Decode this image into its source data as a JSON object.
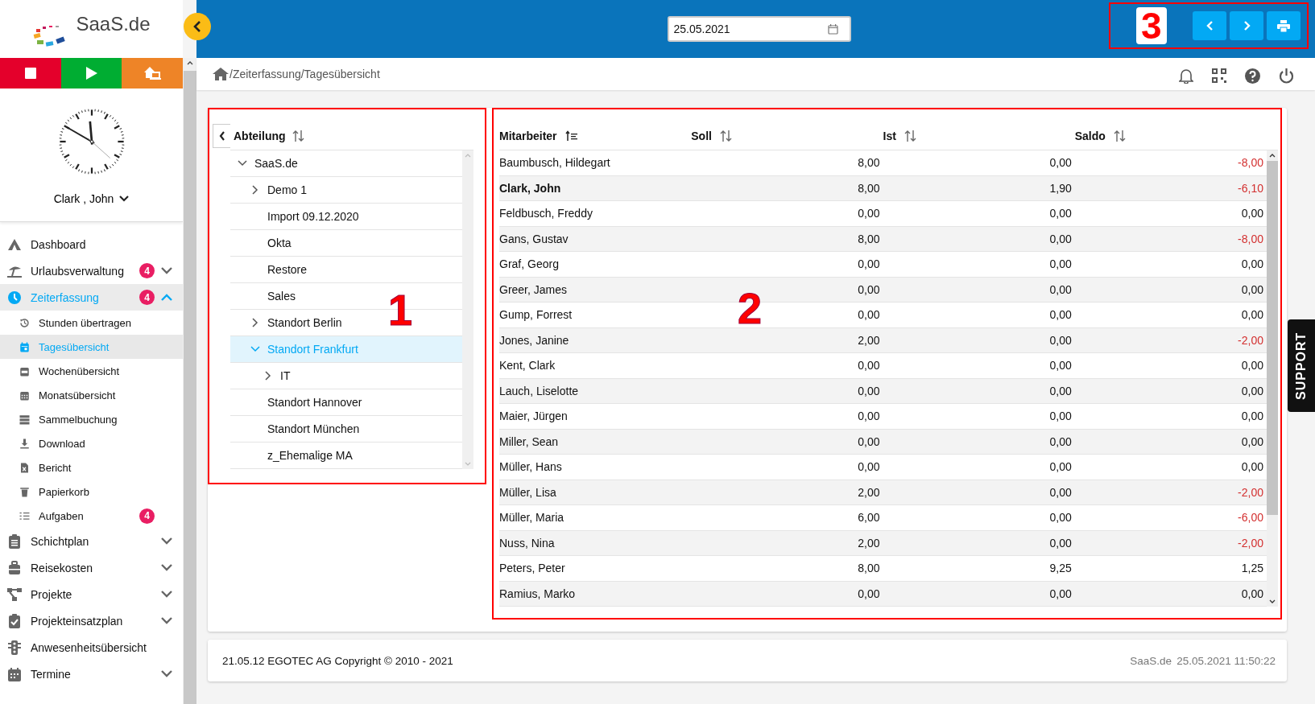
{
  "header": {
    "date": "25.05.2021"
  },
  "sidebar": {
    "logo": "SaaS.de",
    "user": "Clark , John",
    "nav": [
      {
        "label": "Dashboard",
        "kind": "main",
        "selected": false
      },
      {
        "label": "Urlaubsverwaltung",
        "kind": "main",
        "selected": false,
        "badge": "4",
        "expanded": false
      },
      {
        "label": "Zeiterfassung",
        "kind": "main",
        "selected": true,
        "badge": "4",
        "expanded": true
      },
      {
        "label": "Stunden übertragen",
        "kind": "sub",
        "selected": false
      },
      {
        "label": "Tagesübersicht",
        "kind": "sub",
        "selected": true
      },
      {
        "label": "Wochenübersicht",
        "kind": "sub",
        "selected": false
      },
      {
        "label": "Monatsübersicht",
        "kind": "sub",
        "selected": false
      },
      {
        "label": "Sammelbuchung",
        "kind": "sub",
        "selected": false
      },
      {
        "label": "Download",
        "kind": "sub",
        "selected": false
      },
      {
        "label": "Bericht",
        "kind": "sub",
        "selected": false
      },
      {
        "label": "Papierkorb",
        "kind": "sub",
        "selected": false
      },
      {
        "label": "Aufgaben",
        "kind": "sub",
        "selected": false,
        "badge": "4"
      },
      {
        "label": "Schichtplan",
        "kind": "main",
        "selected": false,
        "expanded": false
      },
      {
        "label": "Reisekosten",
        "kind": "main",
        "selected": false,
        "expanded": false
      },
      {
        "label": "Projekte",
        "kind": "main",
        "selected": false,
        "expanded": false
      },
      {
        "label": "Projekteinsatzplan",
        "kind": "main",
        "selected": false,
        "expanded": false
      },
      {
        "label": "Anwesenheitsübersicht",
        "kind": "main",
        "selected": false
      },
      {
        "label": "Termine",
        "kind": "main",
        "selected": false,
        "expanded": false
      }
    ]
  },
  "breadcrumb": "/Zeiterfassung/Tagesübersicht",
  "tree": {
    "header": "Abteilung",
    "nodes": [
      {
        "label": "SaaS.de",
        "selected": false,
        "expanded": true,
        "children": [
          {
            "label": "Demo 1",
            "selected": false,
            "expanded": false
          },
          {
            "label": "Import 09.12.2020",
            "selected": false
          },
          {
            "label": "Okta",
            "selected": false
          },
          {
            "label": "Restore",
            "selected": false
          },
          {
            "label": "Sales",
            "selected": false
          },
          {
            "label": "Standort Berlin",
            "selected": false,
            "expanded": false
          },
          {
            "label": "Standort Frankfurt",
            "selected": true,
            "expanded": true,
            "children": [
              {
                "label": "IT",
                "selected": false,
                "expanded": false
              }
            ]
          },
          {
            "label": "Standort Hannover",
            "selected": false
          },
          {
            "label": "Standort München",
            "selected": false
          },
          {
            "label": "z_Ehemalige MA",
            "selected": false
          }
        ]
      }
    ]
  },
  "table": {
    "columns": [
      {
        "label": "Mitarbeiter",
        "sorted": true
      },
      {
        "label": "Soll",
        "sorted": false
      },
      {
        "label": "Ist",
        "sorted": false
      },
      {
        "label": "Saldo",
        "sorted": false
      }
    ],
    "rows": [
      {
        "name": "Baumbusch, Hildegart",
        "soll": "8,00",
        "ist": "0,00",
        "saldo": "-8,00",
        "negative": true,
        "current": false
      },
      {
        "name": "Clark, John",
        "soll": "8,00",
        "ist": "1,90",
        "saldo": "-6,10",
        "negative": true,
        "current": true
      },
      {
        "name": "Feldbusch, Freddy",
        "soll": "0,00",
        "ist": "0,00",
        "saldo": "0,00",
        "negative": false,
        "current": false
      },
      {
        "name": "Gans, Gustav",
        "soll": "8,00",
        "ist": "0,00",
        "saldo": "-8,00",
        "negative": true,
        "current": false
      },
      {
        "name": "Graf, Georg",
        "soll": "0,00",
        "ist": "0,00",
        "saldo": "0,00",
        "negative": false,
        "current": false
      },
      {
        "name": "Greer, James",
        "soll": "0,00",
        "ist": "0,00",
        "saldo": "0,00",
        "negative": false,
        "current": false
      },
      {
        "name": "Gump, Forrest",
        "soll": "0,00",
        "ist": "0,00",
        "saldo": "0,00",
        "negative": false,
        "current": false
      },
      {
        "name": "Jones, Janine",
        "soll": "2,00",
        "ist": "0,00",
        "saldo": "-2,00",
        "negative": true,
        "current": false
      },
      {
        "name": "Kent, Clark",
        "soll": "0,00",
        "ist": "0,00",
        "saldo": "0,00",
        "negative": false,
        "current": false
      },
      {
        "name": "Lauch, Liselotte",
        "soll": "0,00",
        "ist": "0,00",
        "saldo": "0,00",
        "negative": false,
        "current": false
      },
      {
        "name": "Maier, Jürgen",
        "soll": "0,00",
        "ist": "0,00",
        "saldo": "0,00",
        "negative": false,
        "current": false
      },
      {
        "name": "Miller, Sean",
        "soll": "0,00",
        "ist": "0,00",
        "saldo": "0,00",
        "negative": false,
        "current": false
      },
      {
        "name": "Müller, Hans",
        "soll": "0,00",
        "ist": "0,00",
        "saldo": "0,00",
        "negative": false,
        "current": false
      },
      {
        "name": "Müller, Lisa",
        "soll": "2,00",
        "ist": "0,00",
        "saldo": "-2,00",
        "negative": true,
        "current": false
      },
      {
        "name": "Müller, Maria",
        "soll": "6,00",
        "ist": "0,00",
        "saldo": "-6,00",
        "negative": true,
        "current": false
      },
      {
        "name": "Nuss, Nina",
        "soll": "2,00",
        "ist": "0,00",
        "saldo": "-2,00",
        "negative": true,
        "current": false
      },
      {
        "name": "Peters, Peter",
        "soll": "8,00",
        "ist": "9,25",
        "saldo": "1,25",
        "negative": false,
        "current": false
      },
      {
        "name": "Ramius, Marko",
        "soll": "0,00",
        "ist": "0,00",
        "saldo": "0,00",
        "negative": false,
        "current": false
      }
    ]
  },
  "annotations": [
    {
      "label": "1"
    },
    {
      "label": "2"
    },
    {
      "label": "3"
    }
  ],
  "support_tab": "SUPPORT",
  "footer": {
    "copyright": "21.05.12 EGOTEC AG Copyright © 2010 - 2021",
    "product": "SaaS.de",
    "timestamp": "25.05.2021 11:50:22"
  }
}
